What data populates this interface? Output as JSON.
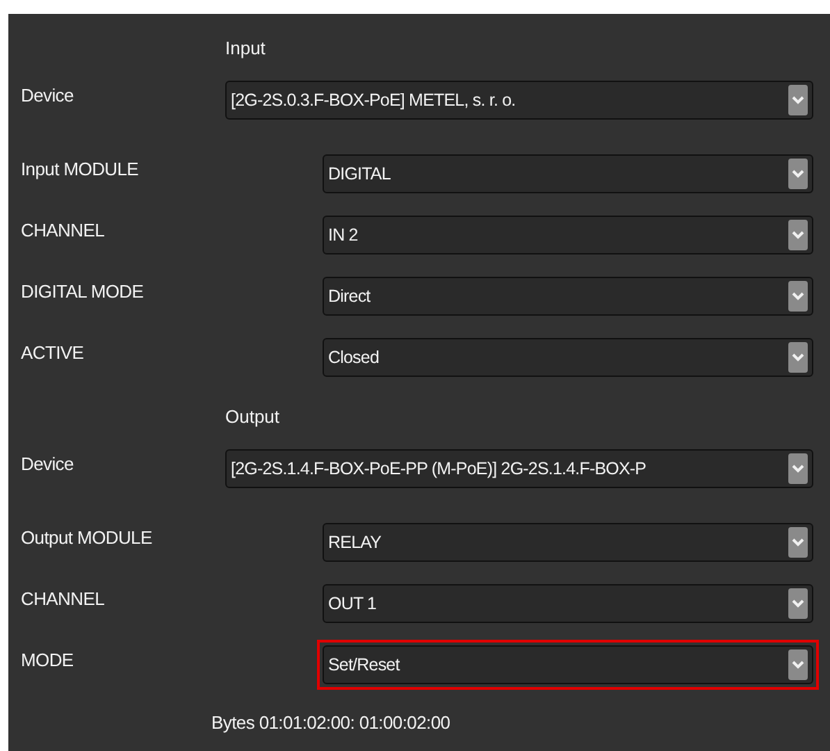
{
  "sections": [
    {
      "heading": "Input",
      "rows": [
        {
          "label": "Device",
          "value": "[2G-2S.0.3.F-BOX-PoE] METEL, s. r. o.",
          "kind": "wide",
          "highlighted": false
        },
        {
          "label": "Input MODULE",
          "value": "DIGITAL",
          "kind": "narrow",
          "highlighted": false
        },
        {
          "label": "CHANNEL",
          "value": "IN 2",
          "kind": "narrow",
          "highlighted": false
        },
        {
          "label": "DIGITAL MODE",
          "value": "Direct",
          "kind": "narrow",
          "highlighted": false
        },
        {
          "label": "ACTIVE",
          "value": "Closed",
          "kind": "narrow",
          "highlighted": false
        }
      ]
    },
    {
      "heading": "Output",
      "rows": [
        {
          "label": "Device",
          "value": "[2G-2S.1.4.F-BOX-PoE-PP (M-PoE)] 2G-2S.1.4.F-BOX-P",
          "kind": "wide",
          "highlighted": false
        },
        {
          "label": "Output MODULE",
          "value": "RELAY",
          "kind": "narrow",
          "highlighted": false
        },
        {
          "label": "CHANNEL",
          "value": "OUT 1",
          "kind": "narrow",
          "highlighted": false
        },
        {
          "label": "MODE",
          "value": "Set/Reset",
          "kind": "narrow",
          "highlighted": true
        }
      ]
    }
  ],
  "bytes": "Bytes 01:01:02:00: 01:00:02:00"
}
